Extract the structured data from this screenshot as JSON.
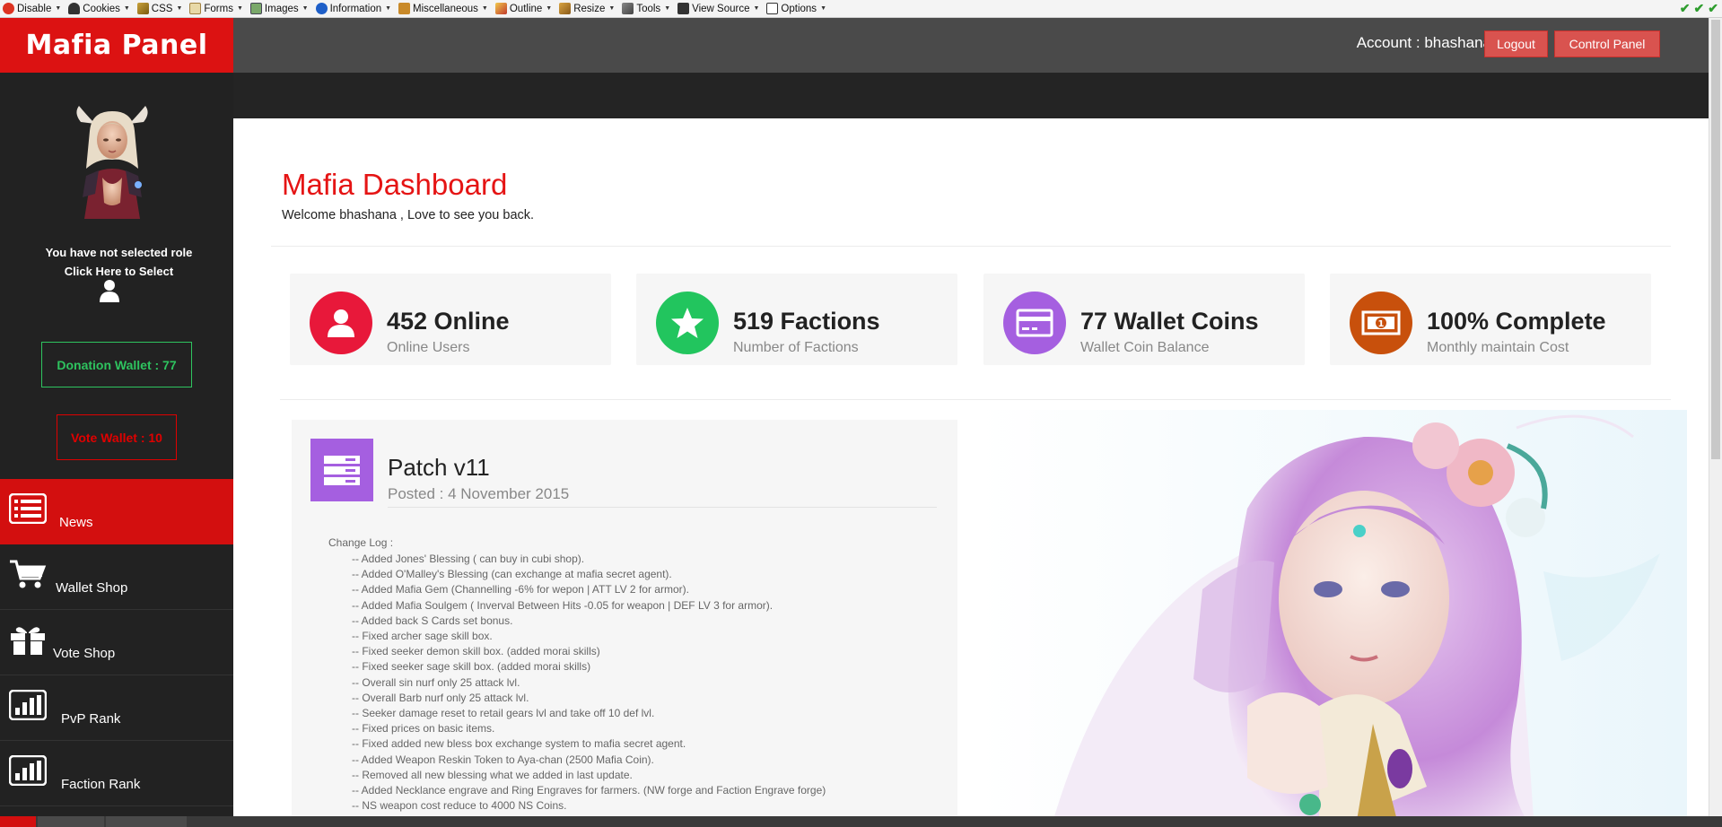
{
  "toolbar": {
    "items": [
      "Disable",
      "Cookies",
      "CSS",
      "Forms",
      "Images",
      "Information",
      "Miscellaneous",
      "Outline",
      "Resize",
      "Tools",
      "View Source",
      "Options"
    ]
  },
  "header": {
    "brand": "Mafia Panel",
    "account": "Account : bhashana",
    "logout_label": "Logout",
    "control_panel_label": "Control Panel"
  },
  "sidebar": {
    "role_line1": "You have not selected role",
    "role_line2": "Click Here to Select",
    "donation_wallet": "Donation Wallet : 77",
    "vote_wallet": "Vote Wallet : 10",
    "nav": [
      {
        "label": "News",
        "icon": "list-icon",
        "active": true
      },
      {
        "label": "Wallet Shop",
        "icon": "cart-icon",
        "active": false
      },
      {
        "label": "Vote Shop",
        "icon": "gift-icon",
        "active": false
      },
      {
        "label": "PvP Rank",
        "icon": "bar-chart-icon",
        "active": false
      },
      {
        "label": "Faction Rank",
        "icon": "bar-chart-icon",
        "active": false
      }
    ]
  },
  "dashboard": {
    "title": "Mafia Dashboard",
    "welcome": "Welcome bhashana , Love to see you back."
  },
  "stats": [
    {
      "value": "452 Online",
      "label": "Online Users",
      "color": "#e8183a",
      "icon": "user-icon"
    },
    {
      "value": "519 Factions",
      "label": "Number of Factions",
      "color": "#22c55e",
      "icon": "star-icon"
    },
    {
      "value": "77 Wallet Coins",
      "label": "Wallet Coin Balance",
      "color": "#a55fe0",
      "icon": "credit-card-icon"
    },
    {
      "value": "100% Complete",
      "label": "Monthly maintain Cost",
      "color": "#c8500c",
      "icon": "money-icon"
    }
  ],
  "patch": {
    "title": "Patch v11",
    "date": "Posted : 4 November 2015",
    "changelog_heading": "Change Log :",
    "changes": [
      "-- Added Jones' Blessing ( can buy in cubi shop).",
      "-- Added O'Malley's Blessing (can exchange at mafia secret agent).",
      "-- Added Mafia Gem (Channelling -6% for wepon | ATT LV  2 for armor).",
      "-- Added Mafia Soulgem ( Inverval Between Hits -0.05 for weapon | DEF LV  3 for armor).",
      "-- Added back S  Cards set bonus.",
      "-- Fixed archer sage skill box.",
      "-- Fixed seeker demon skill box. (added morai skills)",
      "-- Fixed seeker sage skill box. (added morai skills)",
      "-- Overall sin nurf only 25 attack lvl.",
      "-- Overall Barb nurf only 25 attack lvl.",
      "-- Seeker damage reset to retail gears lvl and take off 10 def lvl.",
      "-- Fixed prices on basic items.",
      "-- Fixed added new bless box exchange system to mafia secret agent.",
      "-- Added Weapon Reskin Token to Aya-chan (2500 Mafia Coin).",
      "-- Removed all new blessing what we added in last update.",
      "-- Added Necklance engrave and Ring Engraves for farmers. (NW forge and Faction Engrave forge)",
      "-- NS weapon cost reduce to 4000 NS Coins."
    ]
  },
  "colors": {
    "brand_red": "#dc1212",
    "accent_green": "#2ec45f",
    "header_gray": "#4a4a4a"
  }
}
